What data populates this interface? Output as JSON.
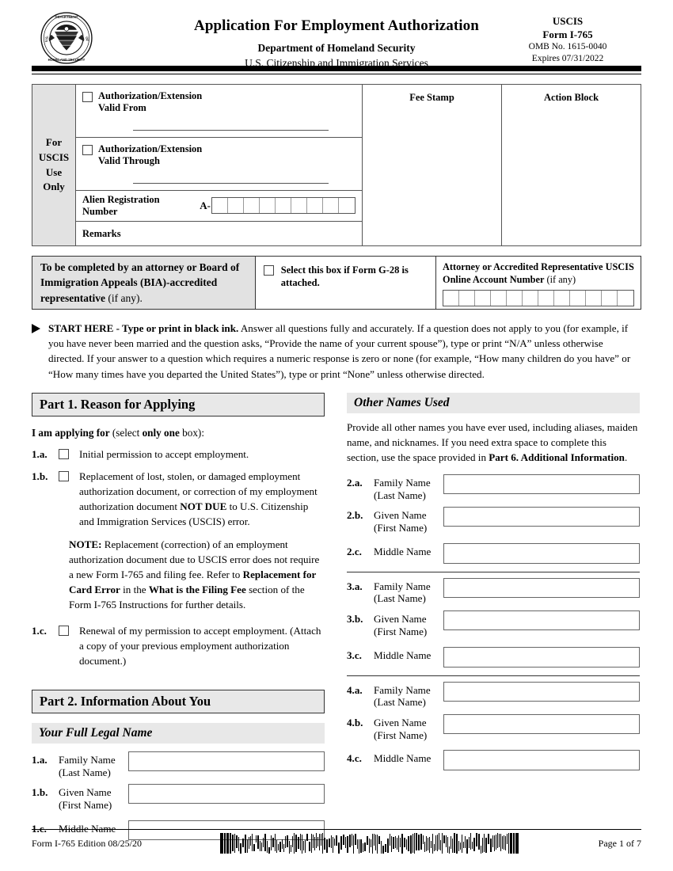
{
  "header": {
    "seal_alt": "dhs-seal",
    "title": "Application For Employment Authorization",
    "subtitle1": "Department of Homeland Security",
    "subtitle2": "U.S. Citizenship and Immigration Services",
    "agency": "USCIS",
    "form_number": "Form I-765",
    "omb": "OMB No. 1615-0040",
    "expires": "Expires 07/31/2022"
  },
  "uscis_use": {
    "side_label": "For USCIS Use Only",
    "valid_from": "Authorization/Extension Valid From",
    "valid_through": "Authorization/Extension Valid Through",
    "alien_registration_label": "Alien Registration Number",
    "alien_prefix": "A-",
    "alien_cell_count": 9,
    "remarks": "Remarks",
    "fee_stamp": "Fee Stamp",
    "action_block": "Action Block"
  },
  "attorney": {
    "left_bold": "To be completed by an attorney or Board of Immigration Appeals (BIA)-accredited representative",
    "left_regular": " (if any).",
    "g28_label": "Select this box if Form G-28 is attached.",
    "account_label": "Attorney or Accredited Representative USCIS Online Account Number",
    "account_regular": " (if any)",
    "account_cell_count": 12
  },
  "start_here": {
    "bold_lead": "START HERE - Type or print in black ink.",
    "body": " Answer all questions fully and accurately.  If a question does not apply to you (for example, if you have never been married and the question asks, “Provide the name of your current spouse”), type or print “N/A” unless otherwise directed.  If your answer to a question which requires a numeric response is zero or none (for example, “How many children do you have” or “How many times have you departed the United States”), type or print “None” unless otherwise directed."
  },
  "part1": {
    "band": "Part 1.  Reason for Applying",
    "lead_bold": "I am applying for",
    "lead_mid": " (select ",
    "lead_bold2": "only one",
    "lead_end": " box):",
    "items": [
      {
        "num": "1.a.",
        "text": "Initial permission to accept employment."
      },
      {
        "num": "1.b.",
        "text": "Replacement of lost, stolen, or damaged employment authorization document, or correction of my employment authorization document NOT DUE to U.S. Citizenship and Immigration Services (USCIS) error."
      },
      {
        "num": "1.c.",
        "text": "Renewal of my permission to accept employment. (Attach a copy of your previous employment authorization document.)"
      }
    ],
    "item_1b_parts": {
      "p1": "Replacement of lost, stolen, or damaged employment authorization document, or correction of my employment authorization document ",
      "bold": "NOT DUE",
      "p2": " to U.S. Citizenship and Immigration Services (USCIS) error."
    },
    "note": {
      "label": "NOTE:",
      "p1": "  Replacement (correction) of an employment authorization document due to USCIS error does not require a new Form I-765 and filing fee.  Refer to ",
      "bold1": "Replacement for Card Error",
      "p2": " in the ",
      "bold2": "What is the Filing Fee",
      "p3": " section of the Form I-765 Instructions for further details."
    }
  },
  "part2": {
    "band": "Part 2.  Information About You",
    "sub_band": "Your Full Legal Name",
    "fields": [
      {
        "num": "1.a.",
        "label_line1": "Family Name",
        "label_line2": "(Last Name)"
      },
      {
        "num": "1.b.",
        "label_line1": "Given Name",
        "label_line2": "(First Name)"
      },
      {
        "num": "1.c.",
        "label_line1": "Middle Name",
        "label_line2": ""
      }
    ]
  },
  "other_names": {
    "sub_band": "Other Names Used",
    "intro_p1": "Provide all other names you have ever used, including aliases, maiden name, and nicknames.  If you need extra space to complete this section, use the space provided in ",
    "intro_bold": "Part 6. Additional Information",
    "intro_p2": ".",
    "groups": [
      {
        "fields": [
          {
            "num": "2.a.",
            "label_line1": "Family Name",
            "label_line2": "(Last Name)"
          },
          {
            "num": "2.b.",
            "label_line1": "Given Name",
            "label_line2": "(First Name)"
          },
          {
            "num": "2.c.",
            "label_line1": "Middle Name",
            "label_line2": ""
          }
        ]
      },
      {
        "fields": [
          {
            "num": "3.a.",
            "label_line1": "Family Name",
            "label_line2": "(Last Name)"
          },
          {
            "num": "3.b.",
            "label_line1": "Given Name",
            "label_line2": "(First Name)"
          },
          {
            "num": "3.c.",
            "label_line1": "Middle Name",
            "label_line2": ""
          }
        ]
      },
      {
        "fields": [
          {
            "num": "4.a.",
            "label_line1": "Family Name",
            "label_line2": "(Last Name)"
          },
          {
            "num": "4.b.",
            "label_line1": "Given Name",
            "label_line2": "(First Name)"
          },
          {
            "num": "4.c.",
            "label_line1": "Middle Name",
            "label_line2": ""
          }
        ]
      }
    ]
  },
  "footer": {
    "form_edition": "Form I-765   Edition   08/25/20",
    "page": "Page 1 of 7",
    "barcode_alt": "2d-barcode"
  }
}
